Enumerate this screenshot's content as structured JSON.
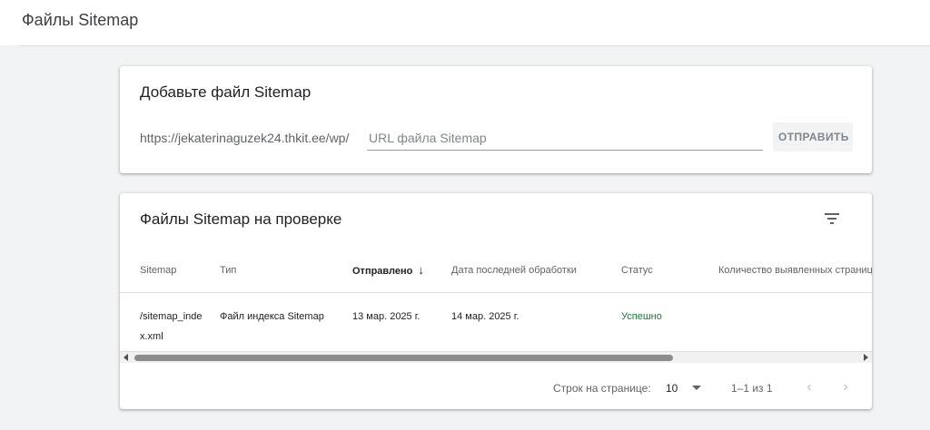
{
  "header": {
    "title": "Файлы Sitemap"
  },
  "add_card": {
    "title": "Добавьте файл Sitemap",
    "url_prefix": "https://jekaterinaguzek24.thkit.ee/wp/",
    "input_placeholder": "URL файла Sitemap",
    "input_value": "",
    "submit_label": "ОТПРАВИТЬ"
  },
  "list_card": {
    "title": "Файлы Sitemap на проверке",
    "filter_icon": "filter-list-icon",
    "columns": [
      "Sitemap",
      "Тип",
      "Отправлено",
      "Дата последней обработки",
      "Статус",
      "Количество выявленных страниц"
    ],
    "sorted_column": "Отправлено",
    "sort_direction": "descending",
    "rows": [
      {
        "sitemap": "/sitemap_index.xml",
        "type": "Файл индекса Sitemap",
        "submitted": "13 мар. 2025 г.",
        "last_read": "14 мар. 2025 г.",
        "status": "Успешно",
        "discovered_pages": ""
      }
    ],
    "status_color": "#188038"
  },
  "pagination": {
    "rows_per_page_label": "Строк на странице:",
    "rows_per_page_value": "10",
    "range_label": "1–1 из 1",
    "prev_icon": "chevron-left-icon",
    "next_icon": "chevron-right-icon"
  }
}
